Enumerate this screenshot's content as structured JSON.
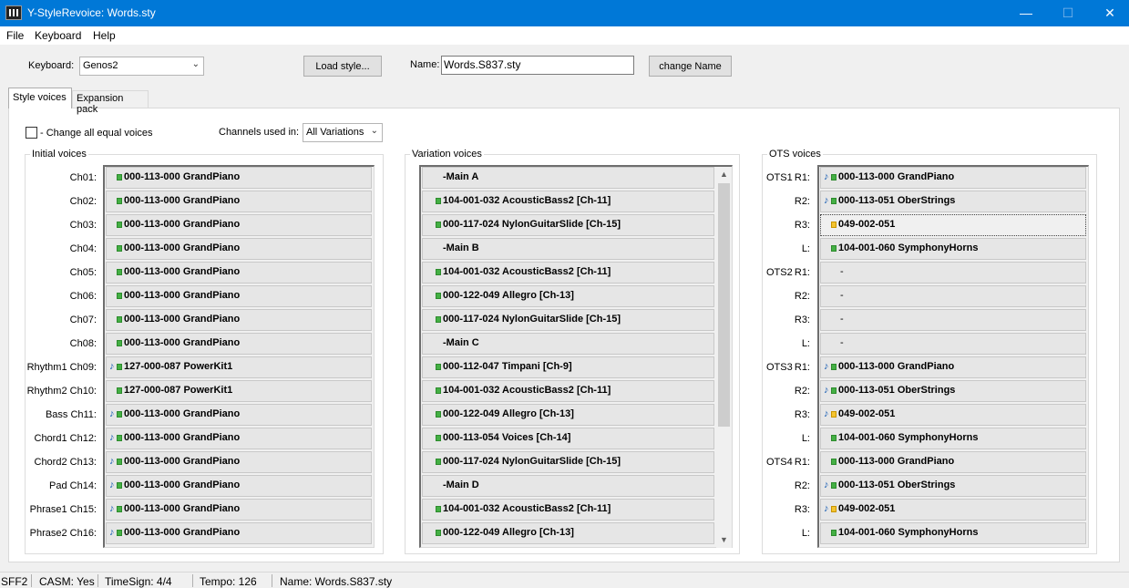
{
  "window": {
    "title": "Y-StyleRevoice: Words.sty",
    "minimize": "—",
    "maximize": "☐",
    "close": "✕"
  },
  "menu": [
    "File",
    "Keyboard",
    "Help"
  ],
  "toolbar": {
    "keyboard_label": "Keyboard:",
    "keyboard_value": "Genos2",
    "load_style_button": "Load style...",
    "name_label": "Name:",
    "name_value": "Words.S837.sty",
    "change_name_button": "change Name"
  },
  "tabs": [
    "Style voices",
    "Expansion pack"
  ],
  "options": {
    "change_all_label": "- Change all equal voices",
    "change_all_checked": false,
    "channels_label": "Channels used in:",
    "channels_value": "All Variations"
  },
  "initial_voices": {
    "title": "Initial voices",
    "rows": [
      {
        "label": "Ch01:",
        "voice": "000-113-000 GrandPiano",
        "note": false,
        "color": "green"
      },
      {
        "label": "Ch02:",
        "voice": "000-113-000 GrandPiano",
        "note": false,
        "color": "green"
      },
      {
        "label": "Ch03:",
        "voice": "000-113-000 GrandPiano",
        "note": false,
        "color": "green"
      },
      {
        "label": "Ch04:",
        "voice": "000-113-000 GrandPiano",
        "note": false,
        "color": "green"
      },
      {
        "label": "Ch05:",
        "voice": "000-113-000 GrandPiano",
        "note": false,
        "color": "green"
      },
      {
        "label": "Ch06:",
        "voice": "000-113-000 GrandPiano",
        "note": false,
        "color": "green"
      },
      {
        "label": "Ch07:",
        "voice": "000-113-000 GrandPiano",
        "note": false,
        "color": "green"
      },
      {
        "label": "Ch08:",
        "voice": "000-113-000 GrandPiano",
        "note": false,
        "color": "green"
      },
      {
        "label": "Rhythm1 Ch09:",
        "voice": "127-000-087 PowerKit1",
        "note": true,
        "color": "green"
      },
      {
        "label": "Rhythm2 Ch10:",
        "voice": "127-000-087 PowerKit1",
        "note": false,
        "color": "green"
      },
      {
        "label": "Bass Ch11:",
        "voice": "000-113-000 GrandPiano",
        "note": true,
        "color": "green"
      },
      {
        "label": "Chord1 Ch12:",
        "voice": "000-113-000 GrandPiano",
        "note": true,
        "color": "green"
      },
      {
        "label": "Chord2 Ch13:",
        "voice": "000-113-000 GrandPiano",
        "note": true,
        "color": "green"
      },
      {
        "label": "Pad Ch14:",
        "voice": "000-113-000 GrandPiano",
        "note": true,
        "color": "green"
      },
      {
        "label": "Phrase1 Ch15:",
        "voice": "000-113-000 GrandPiano",
        "note": true,
        "color": "green"
      },
      {
        "label": "Phrase2 Ch16:",
        "voice": "000-113-000 GrandPiano",
        "note": true,
        "color": "green"
      }
    ]
  },
  "variation_voices": {
    "title": "Variation voices",
    "rows": [
      {
        "text": "-Main A",
        "header": true
      },
      {
        "text": "104-001-032 AcousticBass2 [Ch-11]",
        "header": false
      },
      {
        "text": "000-117-024 NylonGuitarSlide [Ch-15]",
        "header": false
      },
      {
        "text": "-Main B",
        "header": true
      },
      {
        "text": "104-001-032 AcousticBass2 [Ch-11]",
        "header": false
      },
      {
        "text": "000-122-049 Allegro [Ch-13]",
        "header": false
      },
      {
        "text": "000-117-024 NylonGuitarSlide [Ch-15]",
        "header": false
      },
      {
        "text": "-Main C",
        "header": true
      },
      {
        "text": "000-112-047 Timpani [Ch-9]",
        "header": false
      },
      {
        "text": "104-001-032 AcousticBass2 [Ch-11]",
        "header": false
      },
      {
        "text": "000-122-049 Allegro [Ch-13]",
        "header": false
      },
      {
        "text": "000-113-054 Voices [Ch-14]",
        "header": false
      },
      {
        "text": "000-117-024 NylonGuitarSlide [Ch-15]",
        "header": false
      },
      {
        "text": "-Main D",
        "header": true
      },
      {
        "text": "104-001-032 AcousticBass2 [Ch-11]",
        "header": false
      },
      {
        "text": "000-122-049 Allegro [Ch-13]",
        "header": false
      }
    ]
  },
  "ots_voices": {
    "title": "OTS voices",
    "rows": [
      {
        "group": "OTS1",
        "label": "R1:",
        "voice": "000-113-000 GrandPiano",
        "note": true,
        "color": "green"
      },
      {
        "group": "",
        "label": "R2:",
        "voice": "000-113-051 OberStrings",
        "note": true,
        "color": "green"
      },
      {
        "group": "",
        "label": "R3:",
        "voice": "049-002-051",
        "note": false,
        "color": "yellow",
        "selected": true
      },
      {
        "group": "",
        "label": "L:",
        "voice": "104-001-060 SymphonyHorns",
        "note": false,
        "color": "green"
      },
      {
        "group": "OTS2",
        "label": "R1:",
        "voice": "-",
        "note": false,
        "color": "none"
      },
      {
        "group": "",
        "label": "R2:",
        "voice": "-",
        "note": false,
        "color": "none"
      },
      {
        "group": "",
        "label": "R3:",
        "voice": "-",
        "note": false,
        "color": "none"
      },
      {
        "group": "",
        "label": "L:",
        "voice": "-",
        "note": false,
        "color": "none"
      },
      {
        "group": "OTS3",
        "label": "R1:",
        "voice": "000-113-000 GrandPiano",
        "note": true,
        "color": "green"
      },
      {
        "group": "",
        "label": "R2:",
        "voice": "000-113-051 OberStrings",
        "note": true,
        "color": "green"
      },
      {
        "group": "",
        "label": "R3:",
        "voice": "049-002-051",
        "note": true,
        "color": "yellow"
      },
      {
        "group": "",
        "label": "L:",
        "voice": "104-001-060 SymphonyHorns",
        "note": false,
        "color": "green"
      },
      {
        "group": "OTS4",
        "label": "R1:",
        "voice": "000-113-000 GrandPiano",
        "note": false,
        "color": "green"
      },
      {
        "group": "",
        "label": "R2:",
        "voice": "000-113-051 OberStrings",
        "note": true,
        "color": "green"
      },
      {
        "group": "",
        "label": "R3:",
        "voice": "049-002-051",
        "note": true,
        "color": "yellow"
      },
      {
        "group": "",
        "label": "L:",
        "voice": "104-001-060 SymphonyHorns",
        "note": false,
        "color": "green"
      }
    ]
  },
  "status": {
    "format": "SFF2",
    "casm": "CASM: Yes",
    "timesig": "TimeSign: 4/4",
    "tempo": "Tempo: 126",
    "name": "Name: Words.S837.sty"
  },
  "icons": {
    "app": "piano-keys-icon",
    "dropdown": "chevron-down-icon",
    "note": "music-note-icon",
    "voice_marker": "square-icon"
  }
}
